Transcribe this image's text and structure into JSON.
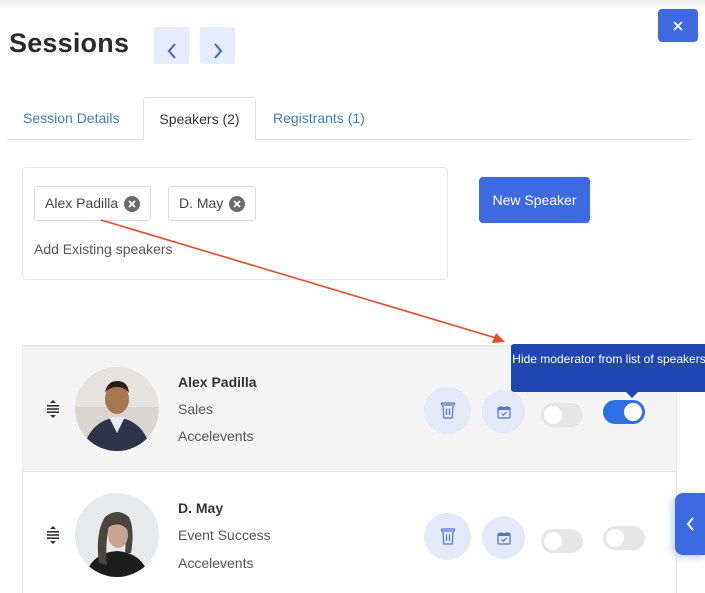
{
  "header": {
    "title": "Sessions",
    "prev_icon": "chevron-left-icon",
    "next_icon": "chevron-right-icon",
    "close_icon": "close-icon"
  },
  "tabs": [
    {
      "label": "Session Details",
      "active": false
    },
    {
      "label": "Speakers (2)",
      "active": true
    },
    {
      "label": "Registrants (1)",
      "active": false
    }
  ],
  "speaker_picker": {
    "selected": [
      {
        "label": "Alex Padilla"
      },
      {
        "label": "D. May"
      }
    ],
    "placeholder": "Add Existing speakers"
  },
  "new_speaker_label": "New Speaker",
  "tooltip": "Hide moderator from list of speakers",
  "speakers": [
    {
      "name": "Alex Padilla",
      "title": "Sales",
      "company": "Accelevents",
      "toggle_1_on": false,
      "toggle_2_on": true
    },
    {
      "name": "D. May",
      "title": "Event Success",
      "company": "Accelevents",
      "toggle_1_on": false,
      "toggle_2_on": false
    }
  ],
  "colors": {
    "primary": "#3d69e1",
    "tooltip": "#1f46b2",
    "toggle_on": "#2f6fe4",
    "link": "#3f7fb8",
    "annotation_arrow": "#e8492b"
  }
}
